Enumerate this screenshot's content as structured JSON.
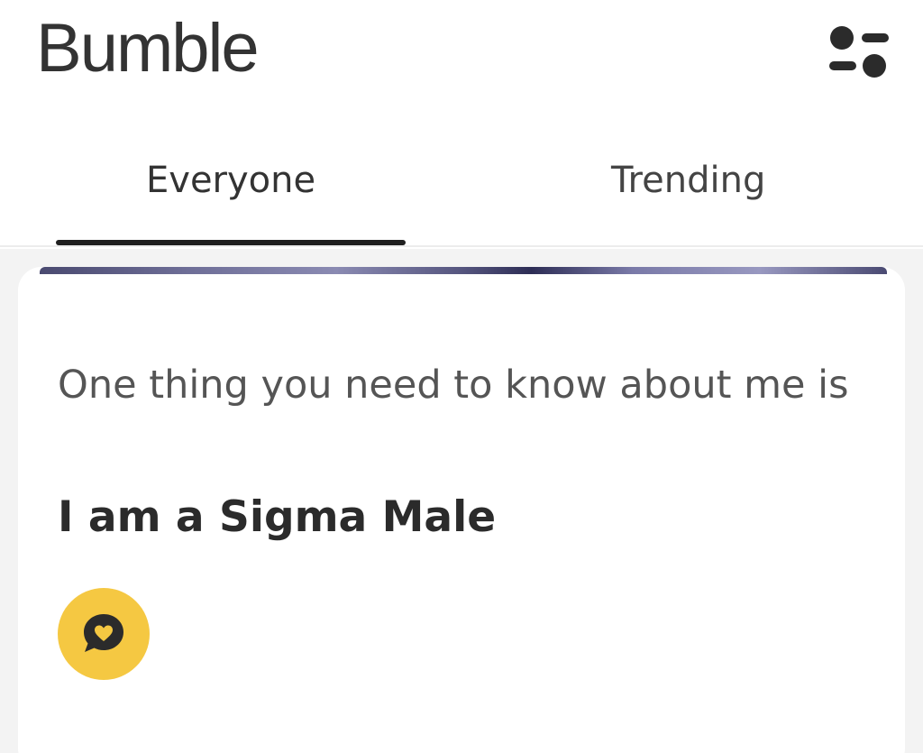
{
  "header": {
    "logo_text": "Bumble",
    "filter_icon": "filter-sliders-icon"
  },
  "tabs": [
    {
      "label": "Everyone",
      "active": true
    },
    {
      "label": "Trending",
      "active": false
    }
  ],
  "card": {
    "prompt_question": "One thing you need to know about me is",
    "prompt_answer": "I am a Sigma Male",
    "reaction_icon": "heart-chat-bubble-icon"
  },
  "colors": {
    "accent": "#f5c842",
    "text_dark": "#2b2b2b",
    "text_muted": "#555555",
    "feed_background": "#f3f3f3"
  }
}
